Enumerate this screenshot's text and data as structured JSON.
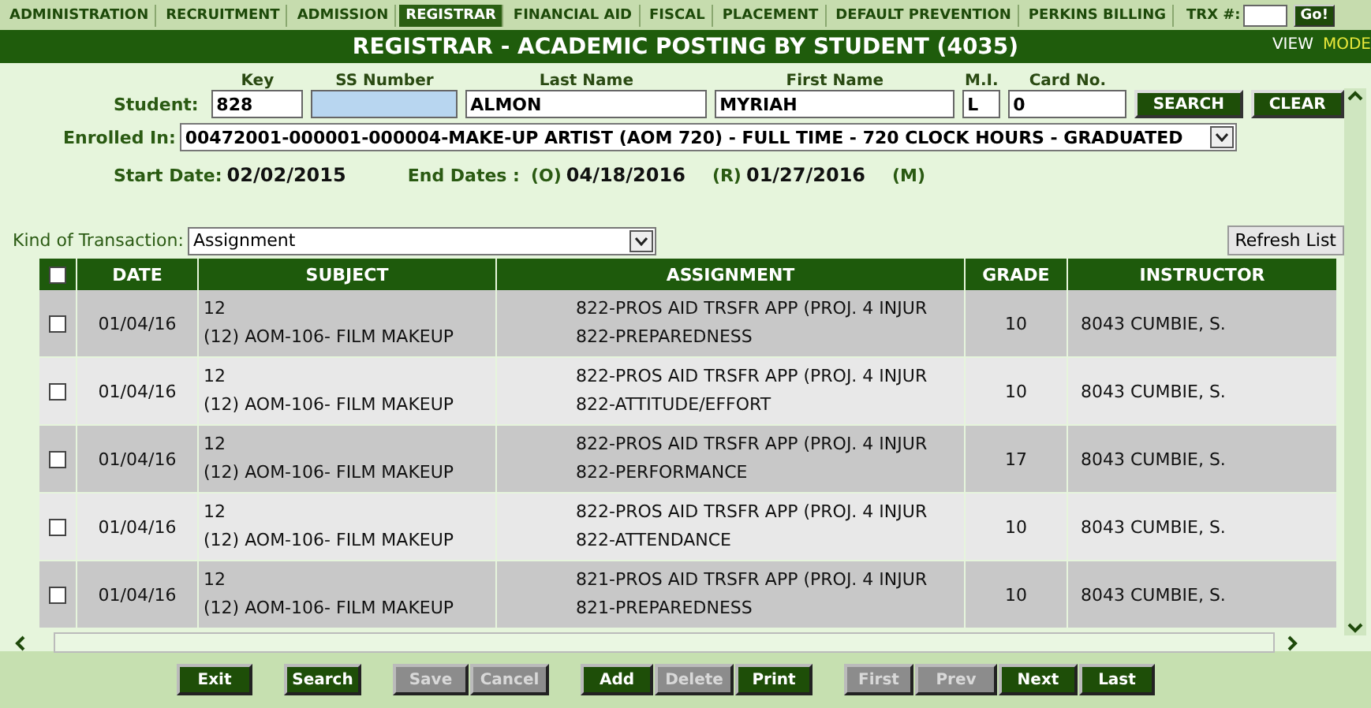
{
  "nav": {
    "tabs": [
      {
        "label": "ADMINISTRATION",
        "selected": false
      },
      {
        "label": "RECRUITMENT",
        "selected": false
      },
      {
        "label": "ADMISSION",
        "selected": false
      },
      {
        "label": "REGISTRAR",
        "selected": true
      },
      {
        "label": "FINANCIAL AID",
        "selected": false
      },
      {
        "label": "FISCAL",
        "selected": false
      },
      {
        "label": "PLACEMENT",
        "selected": false
      },
      {
        "label": "DEFAULT PREVENTION",
        "selected": false
      },
      {
        "label": "PERKINS BILLING",
        "selected": false
      }
    ],
    "trx_label": "TRX #:",
    "go_button": "Go!"
  },
  "title": "REGISTRAR - ACADEMIC POSTING BY STUDENT (4035)",
  "view_links": [
    {
      "label": "VIEW",
      "selected": false
    },
    {
      "label": "MODE",
      "selected": true
    }
  ],
  "student": {
    "label": "Student:",
    "fields": [
      {
        "heading": "Key",
        "value": "828",
        "kind": "text"
      },
      {
        "heading": "SS Number",
        "kind": "highlight"
      },
      {
        "heading": "Last Name",
        "value": "ALMON",
        "kind": "text"
      },
      {
        "heading": "First Name",
        "value": "MYRIAH",
        "kind": "text"
      },
      {
        "heading": "M.I.",
        "value": "L",
        "kind": "text"
      },
      {
        "heading": "Card No.",
        "value": "0",
        "kind": "text"
      }
    ],
    "buttons": [
      "SEARCH",
      "CLEAR"
    ]
  },
  "enrolled": {
    "label": "Enrolled In:",
    "value": "00472001-000001-000004-MAKE-UP ARTIST (AOM 720) - FULL TIME - 720 CLOCK HOURS - GRADUATED"
  },
  "dates": {
    "start_label": "Start Date:",
    "start": "02/02/2015",
    "end_label": "End Dates :",
    "o_label": "(O)",
    "o_value": "04/18/2016",
    "r_label": "(R)",
    "r_value": "01/27/2016",
    "m_label": "(M)"
  },
  "transaction": {
    "label": "Kind of Transaction:",
    "value": "Assignment"
  },
  "refresh_button": "Refresh List",
  "table": {
    "header_checked": false,
    "columns": [
      "DATE",
      "SUBJECT",
      "ASSIGNMENT",
      "GRADE",
      "INSTRUCTOR"
    ],
    "rows": [
      {
        "checked": false,
        "date": "01/04/16",
        "subject": [
          "12",
          "(12) AOM-106- FILM MAKEUP"
        ],
        "assignment": [
          "822-PROS AID TRSFR APP (PROJ. 4 INJUR",
          "822-PREPAREDNESS"
        ],
        "grade": "10",
        "instructor": "8043 CUMBIE, S."
      },
      {
        "checked": false,
        "date": "01/04/16",
        "subject": [
          "12",
          "(12) AOM-106- FILM MAKEUP"
        ],
        "assignment": [
          "822-PROS AID TRSFR APP (PROJ. 4 INJUR",
          "822-ATTITUDE/EFFORT"
        ],
        "grade": "10",
        "instructor": "8043 CUMBIE, S."
      },
      {
        "checked": false,
        "date": "01/04/16",
        "subject": [
          "12",
          "(12) AOM-106- FILM MAKEUP"
        ],
        "assignment": [
          "822-PROS AID TRSFR APP (PROJ. 4 INJUR",
          "822-PERFORMANCE"
        ],
        "grade": "17",
        "instructor": "8043 CUMBIE, S."
      },
      {
        "checked": false,
        "date": "01/04/16",
        "subject": [
          "12",
          "(12) AOM-106- FILM MAKEUP"
        ],
        "assignment": [
          "822-PROS AID TRSFR APP (PROJ. 4 INJUR",
          "822-ATTENDANCE"
        ],
        "grade": "10",
        "instructor": "8043 CUMBIE, S."
      },
      {
        "checked": false,
        "date": "01/04/16",
        "subject": [
          "12",
          "(12) AOM-106- FILM MAKEUP"
        ],
        "assignment": [
          "821-PROS AID TRSFR APP (PROJ. 4 INJUR",
          "821-PREPAREDNESS"
        ],
        "grade": "10",
        "instructor": "8043 CUMBIE, S."
      }
    ]
  },
  "footer": {
    "groups": [
      [
        {
          "label": "Exit",
          "disabled": false
        }
      ],
      [
        {
          "label": "Search",
          "disabled": false
        }
      ],
      [
        {
          "label": "Save",
          "disabled": true
        },
        {
          "label": "Cancel",
          "disabled": true
        }
      ],
      [
        {
          "label": "Add",
          "disabled": false
        },
        {
          "label": "Delete",
          "disabled": true
        },
        {
          "label": "Print",
          "disabled": false
        }
      ],
      [
        {
          "label": "First",
          "disabled": true
        },
        {
          "label": "Prev",
          "disabled": true
        },
        {
          "label": "Next",
          "disabled": false
        },
        {
          "label": "Last",
          "disabled": false
        }
      ]
    ]
  }
}
